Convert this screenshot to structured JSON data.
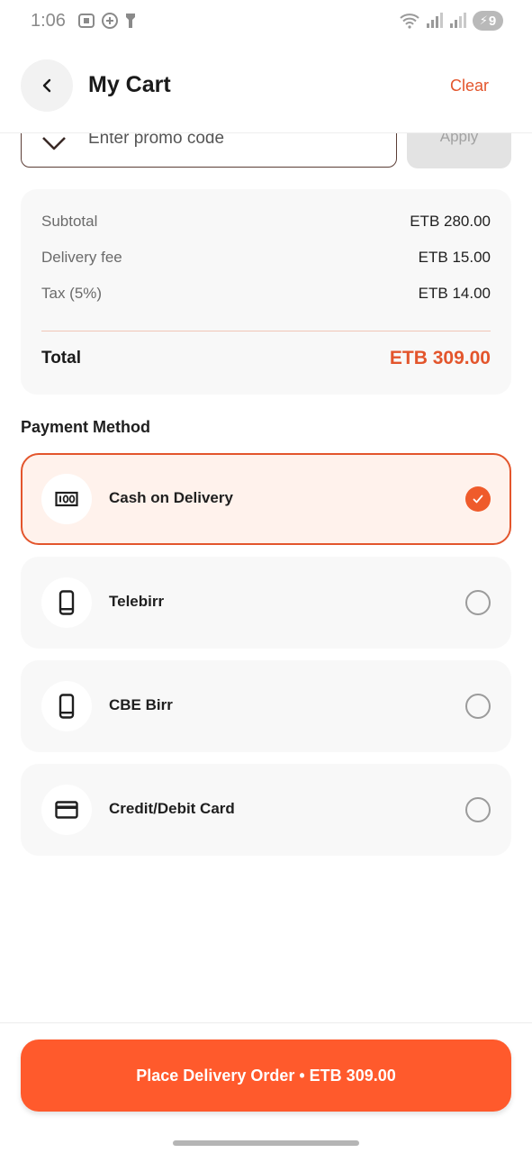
{
  "status_bar": {
    "time": "1:06",
    "battery": "9"
  },
  "header": {
    "title": "My Cart",
    "clear_label": "Clear"
  },
  "promo": {
    "placeholder": "Enter promo code",
    "apply_label": "Apply"
  },
  "summary": {
    "subtotal_label": "Subtotal",
    "subtotal_value": "ETB 280.00",
    "delivery_label": "Delivery fee",
    "delivery_value": "ETB 15.00",
    "tax_label": "Tax (5%)",
    "tax_value": "ETB 14.00",
    "total_label": "Total",
    "total_value": "ETB 309.00"
  },
  "payment": {
    "title": "Payment Method",
    "options": [
      {
        "label": "Cash on Delivery",
        "icon": "cash-icon",
        "selected": true
      },
      {
        "label": "Telebirr",
        "icon": "phone-icon",
        "selected": false
      },
      {
        "label": "CBE Birr",
        "icon": "phone-icon",
        "selected": false
      },
      {
        "label": "Credit/Debit Card",
        "icon": "credit-card-icon",
        "selected": false
      }
    ]
  },
  "footer": {
    "place_order_label": "Place Delivery Order • ETB 309.00"
  },
  "colors": {
    "accent": "#ff5a2c",
    "accent_text": "#e3552c",
    "selected_bg": "#fff2ec"
  }
}
